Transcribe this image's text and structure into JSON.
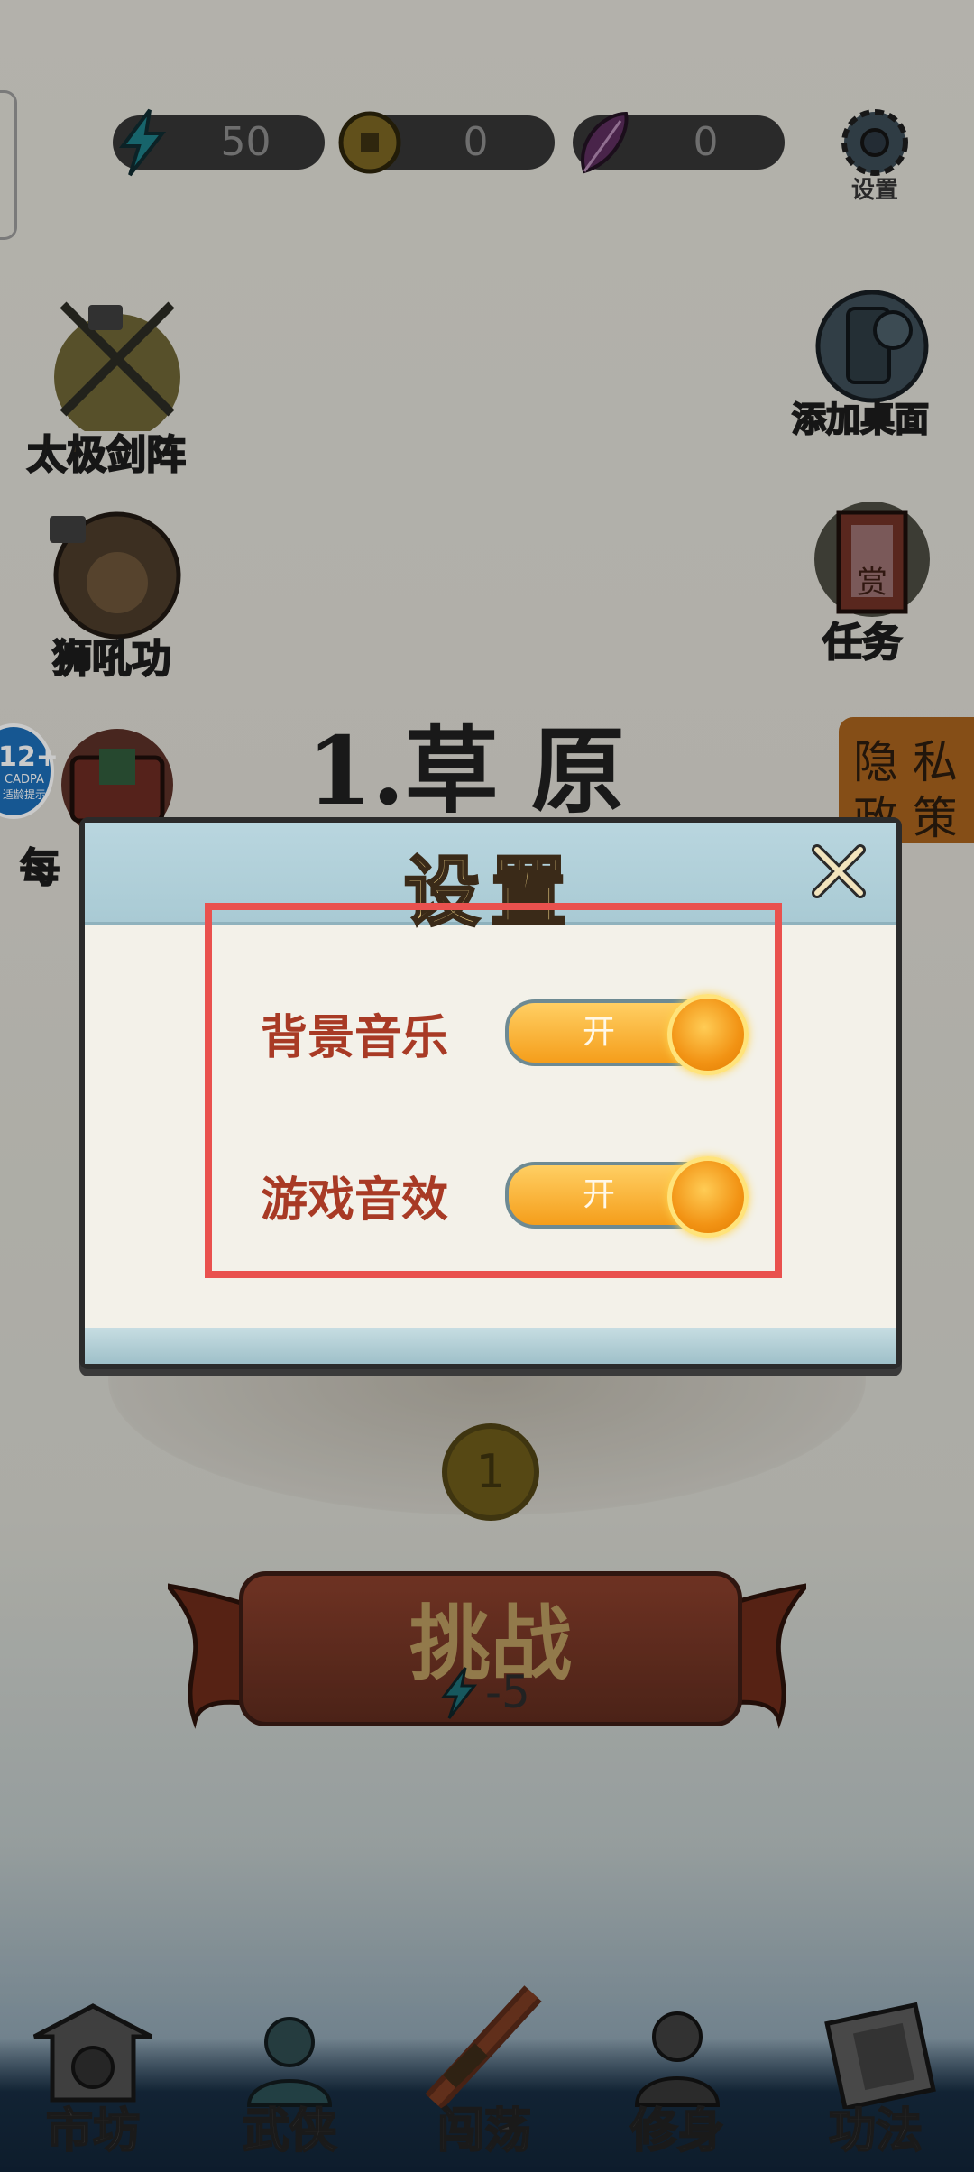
{
  "resources": [
    {
      "icon": "lightning-icon",
      "value": "50"
    },
    {
      "icon": "coin-icon",
      "value": "0"
    },
    {
      "icon": "feather-icon",
      "value": "0"
    }
  ],
  "top_settings": {
    "label": "设置"
  },
  "left_side": [
    {
      "label": "太极剑阵",
      "icon": "sword-formation-icon"
    },
    {
      "label": "狮吼功",
      "icon": "lion-icon"
    },
    {
      "label": "每",
      "icon": "chest-icon"
    }
  ],
  "right_side": [
    {
      "label": "添加桌面",
      "icon": "add-desktop-icon"
    },
    {
      "label": "任务",
      "icon": "scroll-icon",
      "scroll_text": "赏"
    }
  ],
  "age_badge": {
    "line1": "12+",
    "line2": "CADPA",
    "line3": "适龄提示"
  },
  "privacy": {
    "line1": "隐 私",
    "line2": "政 策"
  },
  "stage": {
    "title": "1.草 原",
    "badge": "1"
  },
  "settings_dialog": {
    "title": "设置",
    "rows": [
      {
        "label": "背景音乐",
        "state": "开",
        "on": true
      },
      {
        "label": "游戏音效",
        "state": "开",
        "on": true
      }
    ]
  },
  "challenge": {
    "label": "挑战",
    "cost": "-5"
  },
  "nav": [
    {
      "label": "市坊",
      "icon": "market-icon"
    },
    {
      "label": "武侠",
      "icon": "warrior-icon"
    },
    {
      "label": "闯荡",
      "icon": "adventure-sword-icon"
    },
    {
      "label": "修身",
      "icon": "cultivate-icon"
    },
    {
      "label": "功法",
      "icon": "manual-icon"
    }
  ],
  "colors": {
    "accent": "#f59e1b",
    "highlight": "#e9514e",
    "label": "#a83a25"
  }
}
